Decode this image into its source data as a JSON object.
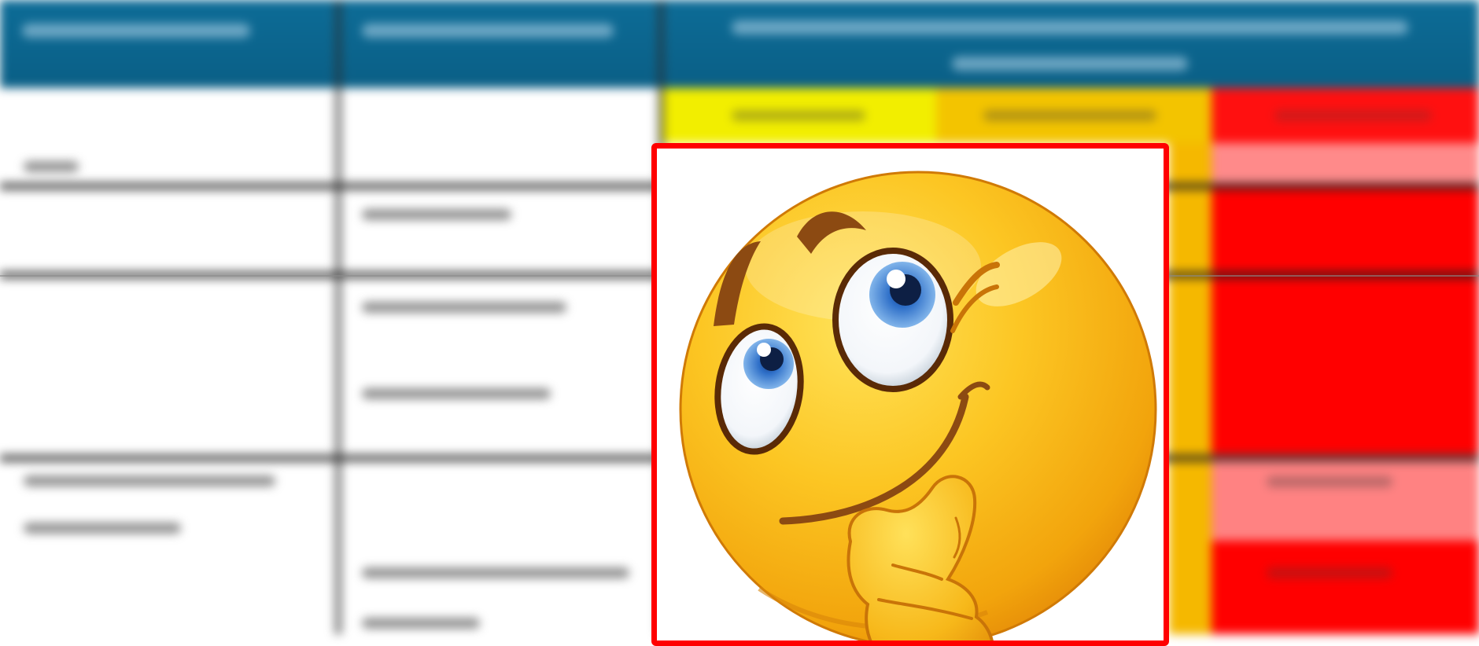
{
  "image": {
    "subject": "thinking-face",
    "colors": {
      "header_blue": "#0a6a95",
      "highlight_yellow": "#f5f000",
      "highlight_orange": "#f6b600",
      "highlight_red": "#ff0000",
      "highlight_pink": "#ff8080",
      "frame_red": "#ff0000",
      "face_yellow": "#fbc51e",
      "face_shadow": "#e9930c",
      "iris_blue": "#3b7ed2"
    },
    "icons": [
      "thinking-face-icon"
    ]
  }
}
